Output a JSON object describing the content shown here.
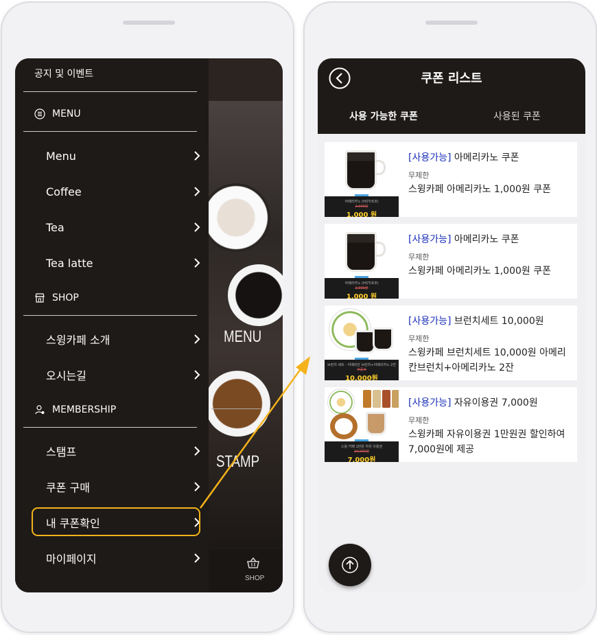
{
  "accent_color": "#f5b21a",
  "left_screen": {
    "notice_label": "공지 및 이벤트",
    "sections": {
      "menu": "MENU",
      "shop": "SHOP",
      "membership": "MEMBERSHIP"
    },
    "menu_items": [
      "Menu",
      "Coffee",
      "Tea",
      "Tea latte"
    ],
    "shop_items": [
      "스윙카페 소개",
      "오시는길"
    ],
    "membership_items": [
      "스탬프",
      "쿠폰 구매",
      "내 쿠폰확인",
      "마이페이지"
    ],
    "highlighted_item": "내 쿠폰확인",
    "background_labels": {
      "menu_word": "MENU",
      "stamp_word": "STAMP",
      "shop_tab": "SHOP"
    }
  },
  "right_screen": {
    "title": "쿠폰 리스트",
    "tabs": [
      "사용 가능한 쿠폰",
      "사용된 쿠폰"
    ],
    "active_tab": "사용 가능한 쿠폰",
    "coupons": [
      {
        "tag": "[사용가능]",
        "name": " 아메리카노 쿠폰",
        "validity": "무제한",
        "description": "스윙카페 아메리카노 1,000원 쿠폰",
        "thumb_caption": "아메리카노 (HOT/ICE)",
        "thumb_old_price": "2,000원",
        "thumb_price": "1,000 원"
      },
      {
        "tag": "[사용가능]",
        "name": " 아메리카노 쿠폰",
        "validity": "무제한",
        "description": "스윙카페 아메리카노 1,000원 쿠폰",
        "thumb_caption": "아메리카노 (HOT/ICE)",
        "thumb_old_price": "2,000원",
        "thumb_price": "1,000 원"
      },
      {
        "tag": "[사용가능]",
        "name": " 브런치세트 10,000원",
        "validity": "무제한",
        "description": "스윙카페 브런치세트 10,000원 아메리칸브런치+아메리카노 2잔",
        "thumb_caption": "브런치 세트 - 아메리칸 브런치+아메리카노 2잔",
        "thumb_old_price": "쿠폰가",
        "thumb_price": "10,000원"
      },
      {
        "tag": "[사용가능]",
        "name": " 자유이용권 7,000원",
        "validity": "무제한",
        "description": "스윙카페 자유이용권 1만원권 할인하여 7,000원에 제공",
        "thumb_caption": "스윙 카페 1만원 자유 이용권",
        "thumb_old_price": "10,000원",
        "thumb_price": "7,000원"
      }
    ]
  }
}
